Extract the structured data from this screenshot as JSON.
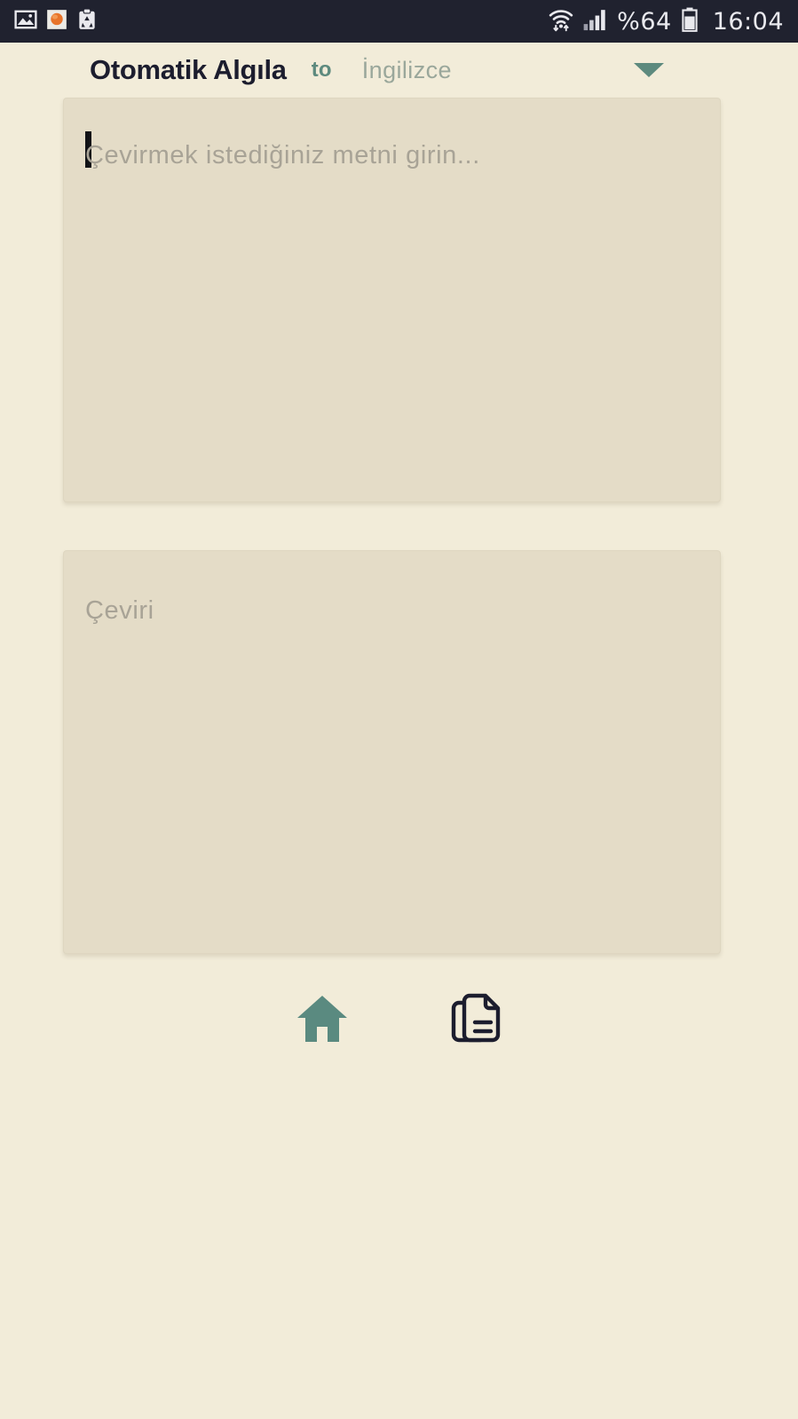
{
  "status_bar": {
    "background_color": "#20222f",
    "left_icons": [
      {
        "name": "gallery-image-icon",
        "label": "Screenshot saved"
      },
      {
        "name": "notification-dot-icon",
        "label": "App notification"
      },
      {
        "name": "clipboard-recycle-icon",
        "label": "Clipboard cleaner"
      }
    ],
    "right_icons": [
      {
        "name": "wifi-signal-icon",
        "label": "Wi-Fi"
      },
      {
        "name": "cellular-signal-icon",
        "label": "Signal"
      }
    ],
    "battery_percent": "%64",
    "battery_icon": "battery-icon",
    "clock": "16:04"
  },
  "language_bar": {
    "source_language": "Otomatik Algıla",
    "connector": "to",
    "target_language": "İngilizce",
    "dropdown_icon": "chevron-down-icon",
    "source_color": "#1c1d2e",
    "connector_color": "#5d8a7e",
    "target_color": "#9aa79b",
    "caret_color": "#5d8a7e"
  },
  "input_panel": {
    "placeholder": "Çevirmek istediğiniz metni girin...",
    "value": "",
    "cursor_visible": true,
    "background_color": "#e4dcc7"
  },
  "output_panel": {
    "placeholder": "Çeviri",
    "value": "",
    "background_color": "#e4dcc7"
  },
  "bottom_nav": {
    "items": [
      {
        "name": "home-icon",
        "label": "Ana Sayfa",
        "active": true,
        "color": "#5a8a80"
      },
      {
        "name": "documents-icon",
        "label": "Belgeler",
        "active": false,
        "color": "#1c1d2e"
      }
    ]
  },
  "theme": {
    "page_background": "#f2ecd9",
    "panel_background": "#e4dcc7",
    "accent": "#5d8a7e",
    "dark": "#1c1d2e"
  }
}
